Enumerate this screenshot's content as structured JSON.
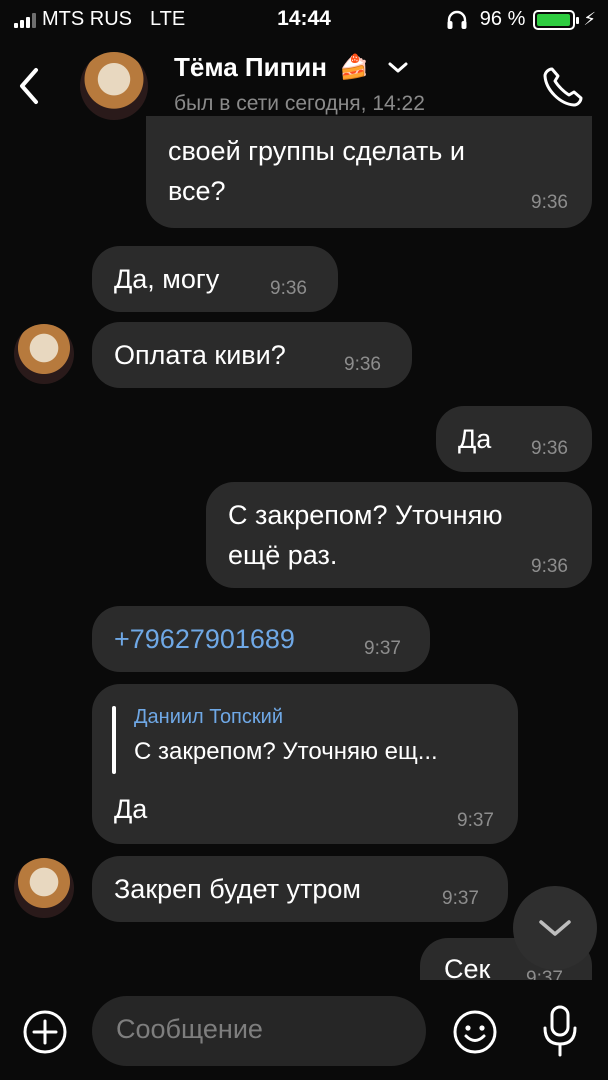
{
  "status_bar": {
    "carrier": "MTS RUS",
    "network": "LTE",
    "time": "14:44",
    "battery": "96 %",
    "battery_level": 0.96,
    "icons": [
      "signal-icon",
      "headphones-icon",
      "battery-icon",
      "charging-icon"
    ]
  },
  "header": {
    "name": "Тёма Пипин",
    "status": "был в сети сегодня, 14:22",
    "icons": [
      "back-icon",
      "avatar",
      "cake-emoji",
      "chevron-down-icon",
      "phone-icon"
    ]
  },
  "messages": [
    {
      "side": "out",
      "text_line1": "своей группы сделать и",
      "text_line2": "все?",
      "time": "9:36"
    },
    {
      "side": "in",
      "text": "Да, могу",
      "time": "9:36"
    },
    {
      "side": "in",
      "text": "Оплата киви?",
      "time": "9:36"
    },
    {
      "side": "out",
      "text": "Да",
      "time": "9:36"
    },
    {
      "side": "out",
      "text_line1": "С закрепом? Уточняю",
      "text_line2": "ещё раз.",
      "time": "9:36"
    },
    {
      "side": "in",
      "text": "+79627901689",
      "time": "9:37"
    },
    {
      "side": "in",
      "reply_name": "Даниил Топский",
      "reply_text": "С закрепом? Уточняю ещ...",
      "text": "Да",
      "time": "9:37"
    },
    {
      "side": "in",
      "text": "Закреп будет утром",
      "time": "9:37"
    },
    {
      "side": "out",
      "text": "Сек",
      "time": "9:37"
    }
  ],
  "composer": {
    "placeholder": "Сообщение",
    "icons": [
      "add-icon",
      "emoji-icon",
      "mic-icon",
      "chevron-down-icon"
    ]
  },
  "colors": {
    "background": "#0a0a0a",
    "bubble": "#2b2b2b",
    "link": "#6fa8e6",
    "time": "#8d8d8d",
    "battery": "#2ecc40"
  }
}
